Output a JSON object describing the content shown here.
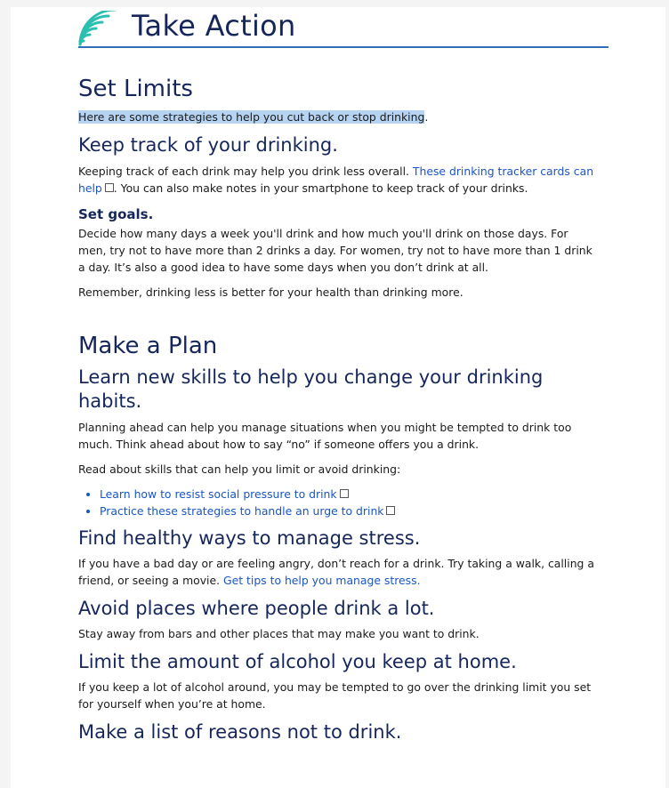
{
  "header": {
    "title": "Take Action"
  },
  "set_limits": {
    "heading": "Set Limits",
    "intro": "Here are some strategies to help you cut back or stop drinking",
    "intro_end": ".",
    "track": {
      "heading": "Keep track of your drinking.",
      "text_before": "Keeping track of each drink may help you drink less overall. ",
      "link": "These drinking tracker cards can help",
      "text_after": ". You can also make notes in your smartphone to keep track of your drinks."
    },
    "goals": {
      "heading": "Set goals.",
      "text": "Decide how many days a week you'll drink and how much you'll drink on those days. For men,  try not to have more than 2 drinks a day. For women, try not to have more than 1 drink a day. It’s also a good idea to have some days when you don’t drink at all.",
      "remember": "Remember, drinking less is better for your health than drinking more."
    }
  },
  "make_plan": {
    "heading": "Make a Plan",
    "skills": {
      "heading": "Learn new skills to help you change your drinking habits.",
      "text": "Planning ahead can help you manage situations when you might be tempted to drink too much. Think ahead about how to say “no” if someone offers you a drink.",
      "read": "Read about skills that can help you limit or avoid drinking:",
      "links": [
        "Learn how to resist social pressure to drink",
        "Practice these strategies to handle an urge to drink"
      ]
    },
    "stress": {
      "heading": "Find healthy ways to manage stress.",
      "text_before": "If you have a bad day or are feeling angry, don’t reach for a drink. Try taking a walk, calling a friend, or seeing a movie. ",
      "link": "Get tips to help you manage stress."
    },
    "places": {
      "heading": "Avoid places where people drink a lot.",
      "text": "Stay away from bars and other places that may make you want to drink."
    },
    "home": {
      "heading": "Limit the amount of alcohol you keep at home.",
      "text": "If you keep a lot of alcohol around, you may be tempted to go over the drinking limit you set for yourself when you’re at home."
    },
    "reasons": {
      "heading": "Make a list of reasons not to drink."
    }
  },
  "colors": {
    "heading": "#16265a",
    "link": "#1a56c4",
    "rule": "#2f6fb7",
    "logo": "#2bbfb0"
  }
}
